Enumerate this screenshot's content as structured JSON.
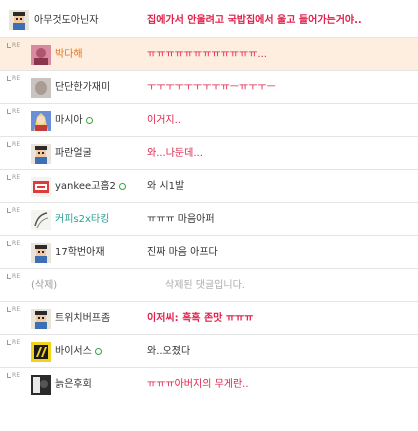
{
  "colors": {
    "highlight_row": "#fdeee0",
    "comment_red": "#e0204a",
    "nick_teal": "#2aa095",
    "nick_orange": "#e8731c",
    "online_green": "#3aa53a"
  },
  "reply_marker": "RE",
  "comments": [
    {
      "avatar": "pixel-character-avatar",
      "nickname": "아무것도아닌자",
      "text": "집에가서 안울려고 국밥집에서 울고 들어가는거야..",
      "style": "red-bold",
      "reply": false
    },
    {
      "avatar": "pink-photo-avatar",
      "nickname": "박다해",
      "text": "ㅠㅠㅠㅠㅠㅠㅠㅠㅠㅠㅠㅠ...",
      "style": "red",
      "reply": true,
      "highlight": true
    },
    {
      "avatar": "blurred-photo-avatar",
      "nickname": "단단한가재미",
      "text": "ㅜㅜㅜㅜㅜㅜㅜㅜㅠㅡㅠㅜㅜㅡ",
      "style": "red",
      "reply": true
    },
    {
      "avatar": "anime-character-avatar",
      "nickname": "마시아",
      "online": true,
      "text": "이거지..",
      "style": "red",
      "reply": true
    },
    {
      "avatar": "pixel-character-avatar",
      "nickname": "파란얼굴",
      "text": "와...나둔데...",
      "style": "red",
      "reply": true
    },
    {
      "avatar": "yankee-logo-avatar",
      "nickname": "yankee고홈2",
      "online": true,
      "text": "와 시1발",
      "style": "normal",
      "reply": true
    },
    {
      "avatar": "sketch-avatar",
      "nickname": "커피s2x타킹",
      "text": "ㅠㅠㅠ 마음아퍼",
      "style": "normal",
      "reply": true
    },
    {
      "avatar": "pixel-character-avatar",
      "nickname": "17학번아재",
      "text": "진짜 마음 아프다",
      "style": "normal",
      "reply": true
    },
    {
      "avatar": "",
      "nickname": "(삭제)",
      "text": "삭제된 댓글입니다.",
      "style": "deleted",
      "reply": true
    },
    {
      "avatar": "pixel-character-avatar",
      "nickname": "트위치버프좀",
      "text": "이저씨: 흑흑 존맛 ㅠㅠㅠ",
      "style": "red-bold",
      "reply": true
    },
    {
      "avatar": "yellow-black-logo-avatar",
      "nickname": "바이서스",
      "online": true,
      "text": "와..오졌다",
      "style": "normal",
      "reply": true
    },
    {
      "avatar": "dark-photo-avatar",
      "nickname": "늙은후회",
      "text": "ㅠㅠㅠ아버지의 무게란..",
      "style": "red",
      "reply": true
    }
  ]
}
